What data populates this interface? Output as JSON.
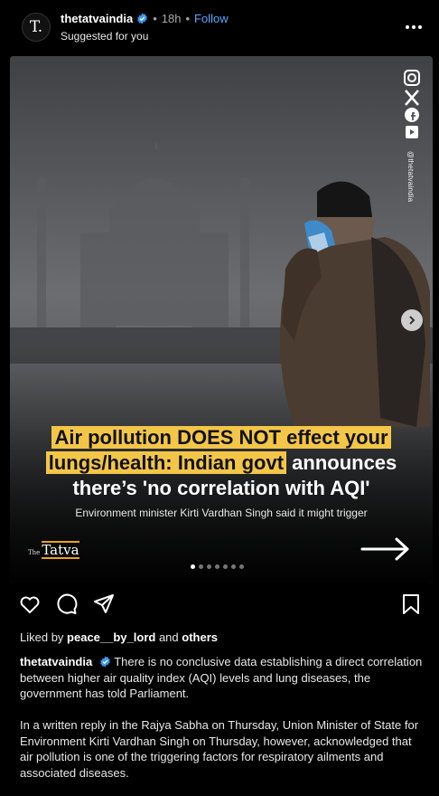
{
  "post": {
    "username": "thetatvaindia",
    "time": "18h",
    "separator": "•",
    "follow_label": "Follow",
    "subtitle": "Suggested for you",
    "avatar_letter": "T."
  },
  "media": {
    "headline_part1": "Air pollution DOES NOT effect your",
    "headline_part2": "lungs/health: Indian govt",
    "headline_part3": " announces",
    "headline_part4": "there’s 'no correlation with AQI'",
    "subhead": "Environment minister Kirti Vardhan Singh said it might trigger",
    "handle": "@thetatvaindia",
    "brand_the": "The",
    "brand_name": "Tatva",
    "carousel_total": 7,
    "carousel_active": 1
  },
  "likes": {
    "prefix": "Liked by ",
    "user": "peace__by_lord",
    "middle": " and ",
    "others": "others"
  },
  "caption": {
    "username": "thetatvaindia",
    "paragraph1": "There is no conclusive data establishing a direct correlation between higher air quality index (AQI) levels and lung diseases, the government has told Parliament.",
    "paragraph2": "In a written reply in the Rajya Sabha on Thursday, Union Minister of State for Environment Kirti Vardhan Singh on Thursday, however, acknowledged that air pollution is one of the triggering factors for respiratory ailments and associated diseases."
  },
  "icons": {
    "verified": "verified-badge-icon",
    "more": "more-options-icon",
    "like": "heart-icon",
    "comment": "comment-icon",
    "share": "share-icon",
    "save": "bookmark-icon",
    "next": "chevron-right-icon"
  },
  "colors": {
    "background": "#000000",
    "follow": "#5aa7ff",
    "verified": "#3897f0",
    "highlight": "#f3c648"
  }
}
